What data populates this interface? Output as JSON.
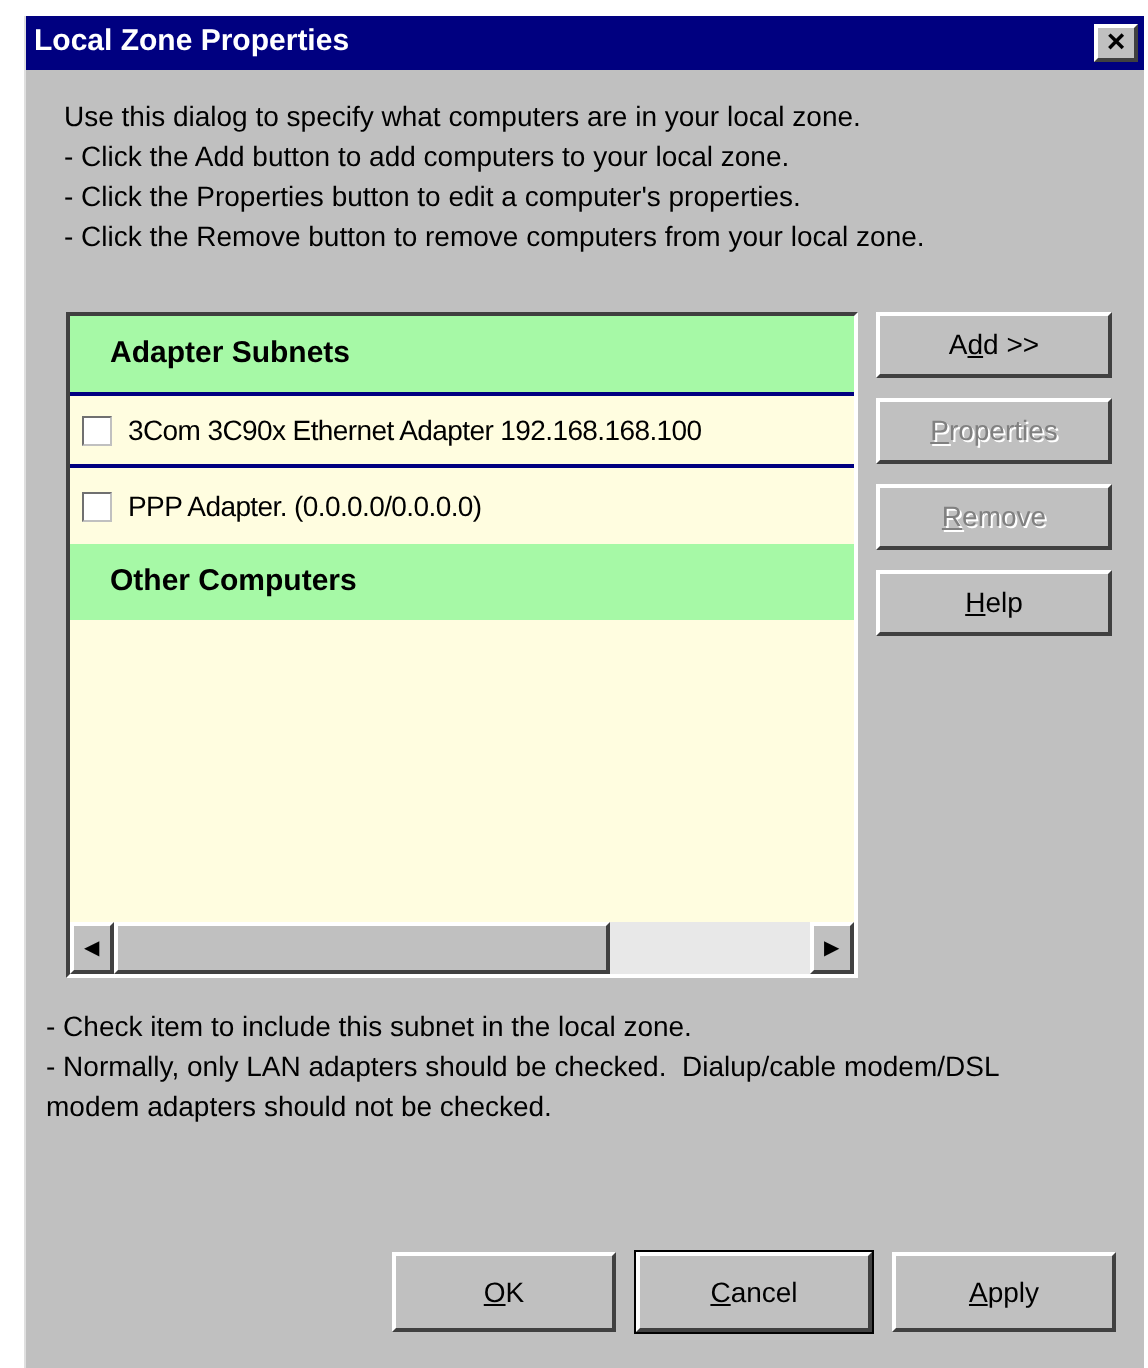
{
  "window": {
    "title": "Local Zone Properties",
    "close": "×"
  },
  "intro": [
    "Use this dialog to specify what computers are in your local zone.",
    "- Click the Add button to add computers to your local zone.",
    "- Click the Properties button to edit a computer's properties.",
    "- Click the Remove button to remove computers from your local zone."
  ],
  "list": {
    "items": [
      {
        "kind": "group",
        "label": "Adapter Subnets"
      },
      {
        "kind": "item",
        "label": "3Com 3C90x Ethernet Adapter 192.168.168.100",
        "checked": false,
        "selected": true
      },
      {
        "kind": "item",
        "label": "PPP Adapter. (0.0.0.0/0.0.0.0)",
        "checked": false,
        "selected": false
      },
      {
        "kind": "group",
        "label": "Other Computers"
      }
    ],
    "scroll_left": "◀",
    "scroll_right": "▶"
  },
  "side_buttons": [
    {
      "label": {
        "prefix": "A",
        "mnemonic": "d",
        "rest": "d >>"
      },
      "disabled": false
    },
    {
      "label": {
        "mnemonic": "P",
        "rest": "roperties"
      },
      "disabled": true
    },
    {
      "label": {
        "mnemonic": "R",
        "rest": "emove"
      },
      "disabled": true
    },
    {
      "label": {
        "mnemonic": "H",
        "rest": "elp"
      },
      "disabled": false
    }
  ],
  "notes": [
    "- Check item to include this subnet in the local zone.",
    "- Normally, only LAN adapters should be checked.  Dialup/cable modem/DSL modem adapters should not be checked."
  ],
  "buttons": [
    {
      "label": {
        "mnemonic": "O",
        "rest": "K"
      },
      "default": false
    },
    {
      "label": {
        "mnemonic": "C",
        "rest": "ancel"
      },
      "default": true
    },
    {
      "label": {
        "mnemonic": "A",
        "rest": "pply"
      },
      "default": false
    }
  ]
}
